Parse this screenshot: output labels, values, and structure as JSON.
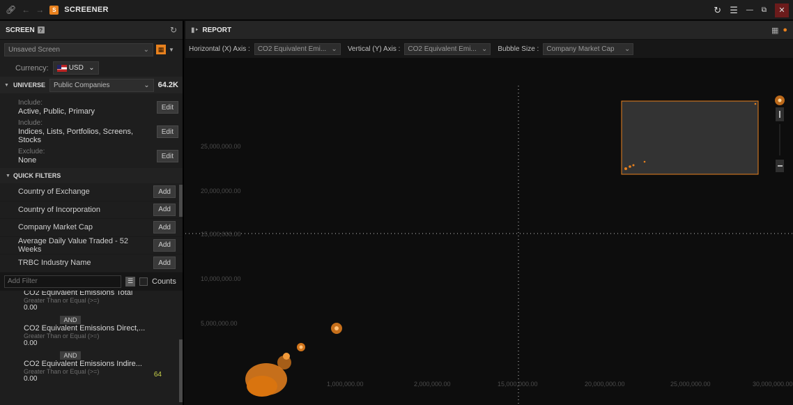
{
  "app": {
    "title": "SCREENER"
  },
  "screen_panel": {
    "header": "SCREEN",
    "screen_select": "Unsaved Screen",
    "currency_label": "Currency:",
    "currency_value": "USD",
    "universe": {
      "label": "UNIVERSE",
      "value": "Public Companies",
      "count": "64.2K"
    },
    "include_1": {
      "label": "Include:",
      "value": "Active, Public, Primary",
      "button": "Edit"
    },
    "include_2": {
      "label": "Include:",
      "value": "Indices, Lists, Portfolios, Screens, Stocks",
      "button": "Edit"
    },
    "exclude": {
      "label": "Exclude:",
      "value": "None",
      "button": "Edit"
    },
    "quick_filters_label": "QUICK FILTERS",
    "quick_filters": [
      {
        "label": "Country of Exchange",
        "button": "Add"
      },
      {
        "label": "Country of Incorporation",
        "button": "Add"
      },
      {
        "label": "Company Market Cap",
        "button": "Add"
      },
      {
        "label": "Average Daily Value Traded - 52 Weeks",
        "button": "Add"
      },
      {
        "label": "TRBC Industry Name",
        "button": "Add"
      }
    ],
    "add_filter_placeholder": "Add Filter",
    "counts_label": "Counts",
    "filters": [
      {
        "title": "CO2 Equivalent Emissions Total",
        "condition": "Greater Than or Equal (>=)",
        "value": "0.00"
      },
      {
        "title": "CO2 Equivalent Emissions Direct,...",
        "condition": "Greater Than or Equal (>=)",
        "value": "0.00"
      },
      {
        "title": "CO2 Equivalent Emissions Indire...",
        "condition": "Greater Than or Equal (>=)",
        "value": "0.00",
        "count": "64"
      }
    ],
    "and_label": "AND"
  },
  "report_panel": {
    "header": "REPORT",
    "x_axis_label": "Horizontal (X) Axis :",
    "x_axis_value": "CO2 Equivalent Emi...",
    "y_axis_label": "Vertical (Y) Axis :",
    "y_axis_value": "CO2 Equivalent Emi...",
    "bubble_label": "Bubble Size :",
    "bubble_value": "Company Market Cap"
  },
  "chart_data": {
    "type": "scatter",
    "y_ticks": [
      "25,000,000.00",
      "20,000,000.00",
      "15,000,000.00",
      "10,000,000.00",
      "5,000,000.00"
    ],
    "x_ticks": [
      "1,000,000.00",
      "2,000,000.00",
      "15,000,000.00",
      "20,000,000.00",
      "25,000,000.00",
      "30,000,000.00"
    ],
    "bubble_color": "#e8811e"
  }
}
